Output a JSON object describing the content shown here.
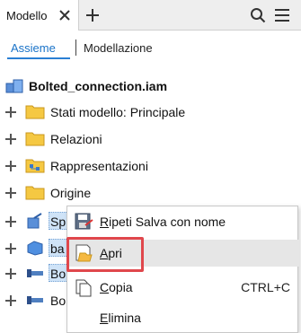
{
  "panel": {
    "tab_label": "Modello",
    "subtabs": {
      "active": "Assieme",
      "inactive": "Modellazione"
    }
  },
  "tree": {
    "root": "Bolted_connection.iam",
    "folders": [
      {
        "label": "Stati modello: Principale"
      },
      {
        "label": "Relazioni"
      },
      {
        "label": "Rappresentazioni"
      },
      {
        "label": "Origine"
      }
    ],
    "partial_items": [
      {
        "label": "Sp"
      },
      {
        "label": "ba"
      },
      {
        "label": "Bo"
      },
      {
        "label": "Bo"
      }
    ]
  },
  "context_menu": {
    "items": [
      {
        "label": "Ripeti Salva con nome",
        "mnemonic": "R",
        "rest": "ipeti Salva con nome",
        "shortcut": ""
      },
      {
        "label": "Apri",
        "mnemonic": "A",
        "rest": "pri",
        "shortcut": ""
      },
      {
        "label": "Copia",
        "mnemonic": "C",
        "rest": "opia",
        "shortcut": "CTRL+C"
      },
      {
        "label": "Elimina",
        "mnemonic": "E",
        "rest": "limina",
        "shortcut": ""
      }
    ]
  },
  "colors": {
    "accent": "#1a73c8",
    "highlight_border": "#e0474c",
    "folder": "#f5c842"
  },
  "icons": [
    "close-icon",
    "plus-icon",
    "search-icon",
    "menu-icon",
    "assembly-icon",
    "folder-icon",
    "expand-icon",
    "save-icon",
    "open-icon",
    "copy-icon"
  ]
}
